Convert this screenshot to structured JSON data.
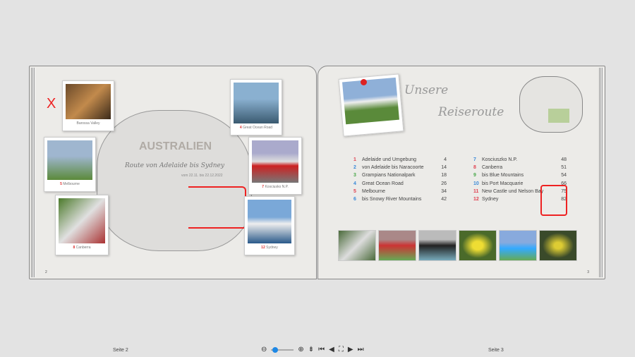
{
  "left_page": {
    "title": "AUSTRALIEN",
    "subtitle": "Route von Adelaide bis Sydney",
    "date": "vom 22.11. bis 22.12.2022",
    "page_number": "2",
    "photos": [
      {
        "num": "",
        "label": "Barossa Valley"
      },
      {
        "num": "5",
        "label": "Melbourne"
      },
      {
        "num": "8",
        "label": "Canberra"
      },
      {
        "num": "4",
        "label": "Great Ocean Road"
      },
      {
        "num": "7",
        "label": "Kosciusko N.P."
      },
      {
        "num": "12",
        "label": "Sydney"
      }
    ],
    "mark": "X"
  },
  "right_page": {
    "title_line1": "Unsere",
    "title_line2": "Reiseroute",
    "page_number": "3",
    "toc": [
      {
        "num": "1",
        "title": "Adelaide und Umgebung",
        "page": "4",
        "color": "#e04050"
      },
      {
        "num": "2",
        "title": "von Adelaide bis Naracoorte",
        "page": "14",
        "color": "#3a8ad8"
      },
      {
        "num": "3",
        "title": "Grampians Nationalpark",
        "page": "18",
        "color": "#4aa84a"
      },
      {
        "num": "4",
        "title": "Great Ocean Road",
        "page": "26",
        "color": "#3a8ad8"
      },
      {
        "num": "5",
        "title": "Melbourne",
        "page": "34",
        "color": "#e04050"
      },
      {
        "num": "6",
        "title": "bis Snowy River Mountains",
        "page": "42",
        "color": "#3a8ad8"
      },
      {
        "num": "7",
        "title": "Kosciuszko N.P.",
        "page": "48",
        "color": "#3a8ad8"
      },
      {
        "num": "8",
        "title": "Canberra",
        "page": "51",
        "color": "#e04050"
      },
      {
        "num": "9",
        "title": "bis Blue Mountains",
        "page": "54",
        "color": "#4aa84a"
      },
      {
        "num": "10",
        "title": "bis Port Macquarie",
        "page": "66",
        "color": "#3a8ad8"
      },
      {
        "num": "11",
        "title": "New Castle und Nelson Bay",
        "page": "75",
        "color": "#e04050"
      },
      {
        "num": "12",
        "title": "Sydney",
        "page": "82",
        "color": "#e04050"
      }
    ]
  },
  "footer": {
    "left": "Seite 2",
    "right": "Seite 3",
    "zoom_percent": 10
  }
}
